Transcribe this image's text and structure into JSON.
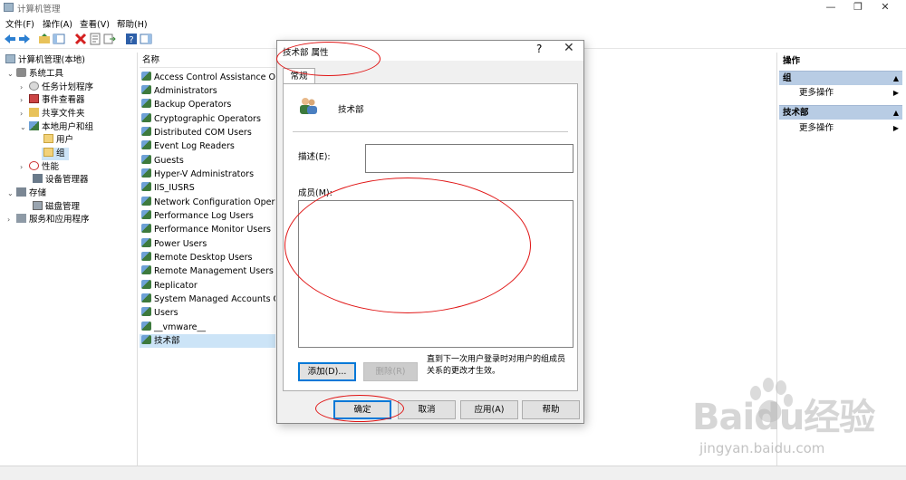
{
  "window": {
    "title": "计算机管理"
  },
  "menu": [
    "文件(F)",
    "操作(A)",
    "查看(V)",
    "帮助(H)"
  ],
  "tree": {
    "root": "计算机管理(本地)",
    "system_tools": "系统工具",
    "task_scheduler": "任务计划程序",
    "event_viewer": "事件查看器",
    "shared_folders": "共享文件夹",
    "local_users_groups": "本地用户和组",
    "users": "用户",
    "groups": "组",
    "performance": "性能",
    "device_manager": "设备管理器",
    "storage": "存储",
    "disk_management": "磁盘管理",
    "services_apps": "服务和应用程序"
  },
  "list": {
    "header": "名称",
    "rows": [
      "Access Control Assistance Operators",
      "Administrators",
      "Backup Operators",
      "Cryptographic Operators",
      "Distributed COM Users",
      "Event Log Readers",
      "Guests",
      "Hyper-V Administrators",
      "IIS_IUSRS",
      "Network Configuration Operators",
      "Performance Log Users",
      "Performance Monitor Users",
      "Power Users",
      "Remote Desktop Users",
      "Remote Management Users",
      "Replicator",
      "System Managed Accounts Group",
      "Users",
      "__vmware__",
      "技术部"
    ]
  },
  "actions": {
    "header": "操作",
    "section1": "组",
    "more1": "更多操作",
    "section2": "技术部",
    "more2": "更多操作"
  },
  "dialog": {
    "title": "技术部 属性",
    "help_glyph": "?",
    "close_glyph": "✕",
    "tab": "常规",
    "group_name": "技术部",
    "description_label": "描述(E):",
    "description_value": "",
    "members_label": "成员(M):",
    "add_button": "添加(D)...",
    "remove_button": "删除(R)",
    "note": "直到下一次用户登录时对用户的组成员关系的更改才生效。",
    "ok_button": "确定",
    "cancel_button": "取消",
    "apply_button": "应用(A)",
    "help_button": "帮助"
  },
  "watermark": {
    "logo": "Baidu经验",
    "url": "jingyan.baidu.com"
  },
  "colors": {
    "annotation": "#e01414",
    "selection": "#cce4f7",
    "action_section": "#b8cce4",
    "default_button_border": "#0078d7"
  }
}
